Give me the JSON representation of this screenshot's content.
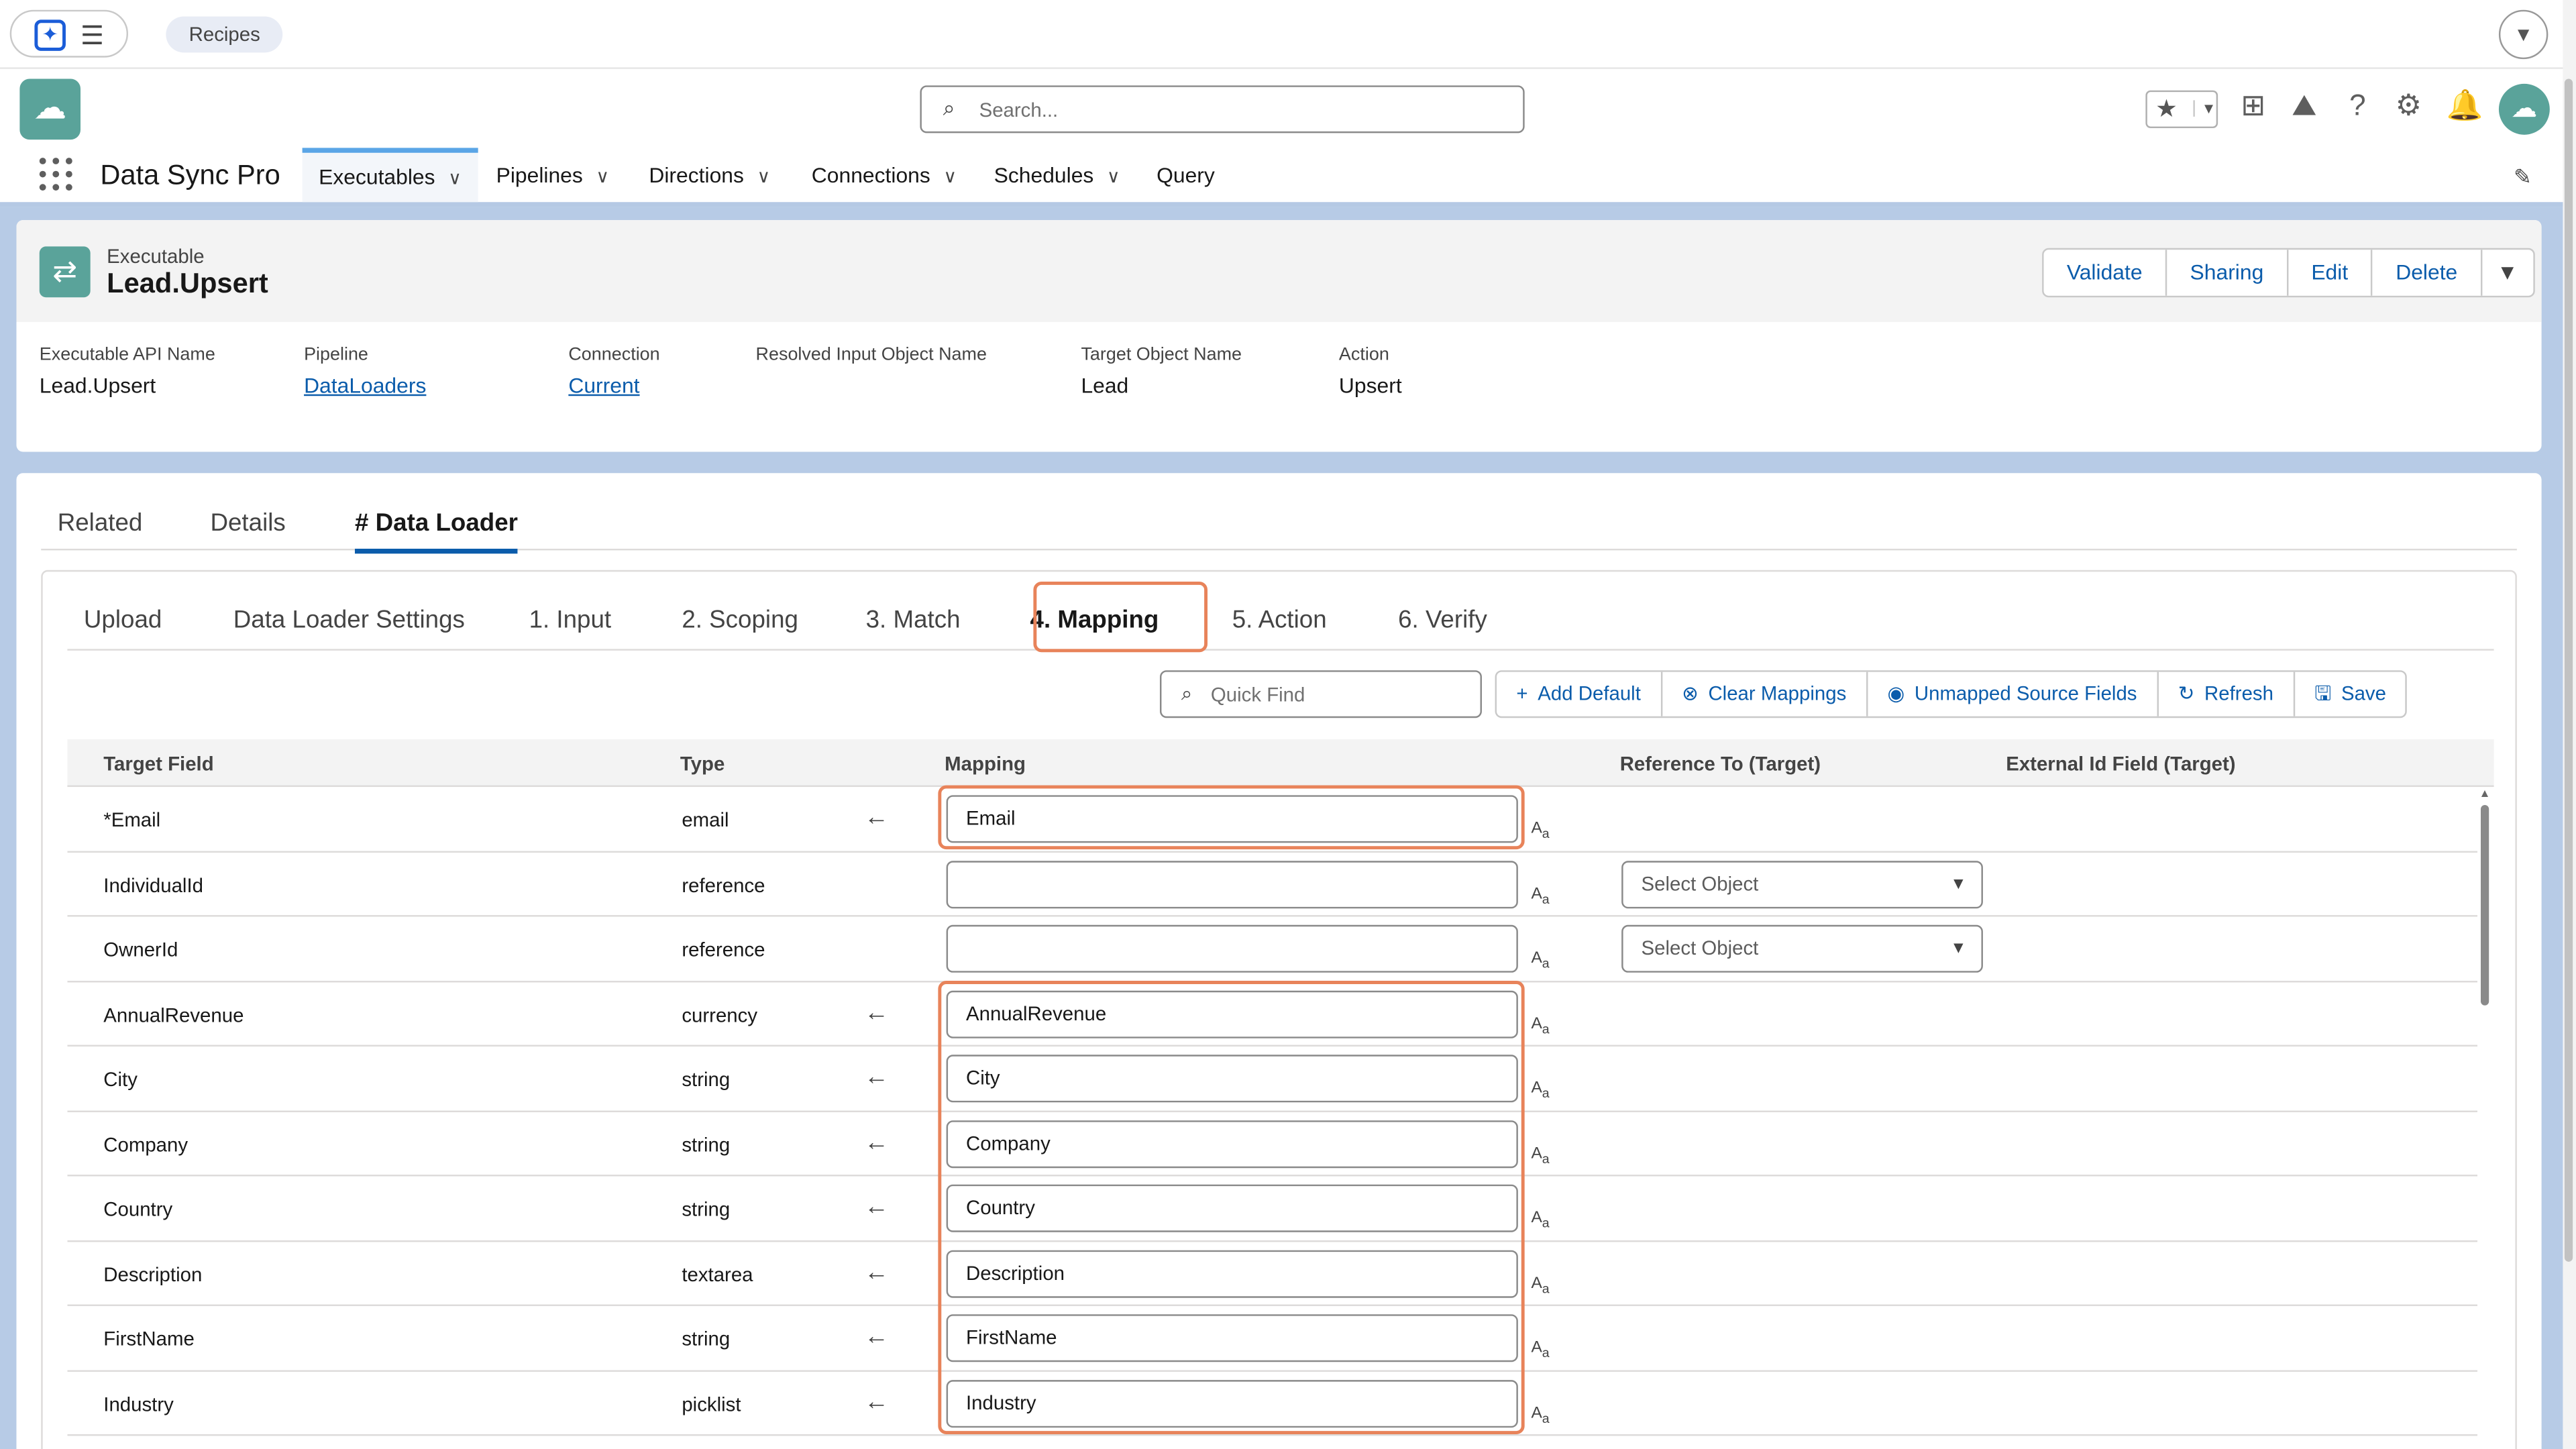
{
  "browser": {
    "tab_label": "Recipes"
  },
  "header": {
    "search_placeholder": "Search..."
  },
  "appnav": {
    "app_name": "Data Sync Pro",
    "items": [
      {
        "label": "Executables",
        "active": true,
        "has_menu": true
      },
      {
        "label": "Pipelines",
        "has_menu": true
      },
      {
        "label": "Directions",
        "has_menu": true
      },
      {
        "label": "Connections",
        "has_menu": true
      },
      {
        "label": "Schedules",
        "has_menu": true
      },
      {
        "label": "Query",
        "has_menu": false
      }
    ]
  },
  "record": {
    "object_type": "Executable",
    "name": "Lead.Upsert",
    "actions": [
      "Validate",
      "Sharing",
      "Edit",
      "Delete"
    ],
    "fields": [
      {
        "label": "Executable API Name",
        "value": "Lead.Upsert",
        "link": false
      },
      {
        "label": "Pipeline",
        "value": "DataLoaders",
        "link": true
      },
      {
        "label": "Connection",
        "value": "Current",
        "link": true
      },
      {
        "label": "Resolved Input Object Name",
        "value": "",
        "link": false
      },
      {
        "label": "Target Object Name",
        "value": "Lead",
        "link": false
      },
      {
        "label": "Action",
        "value": "Upsert",
        "link": false
      }
    ]
  },
  "tabs": [
    "Related",
    "Details",
    "# Data Loader"
  ],
  "active_tab": "# Data Loader",
  "subtabs": [
    "Upload",
    "Data Loader Settings",
    "1. Input",
    "2. Scoping",
    "3. Match",
    "4. Mapping",
    "5. Action",
    "6. Verify"
  ],
  "active_subtab": "4. Mapping",
  "toolbar": {
    "quick_find_placeholder": "Quick Find",
    "buttons": [
      "Add Default",
      "Clear Mappings",
      "Unmapped Source Fields",
      "Refresh",
      "Save"
    ]
  },
  "table": {
    "columns": [
      "Target Field",
      "Type",
      "Mapping",
      "Reference To (Target)",
      "External Id Field (Target)"
    ],
    "select_placeholder": "Select Object",
    "type_indicator": "Aa",
    "rows": [
      {
        "target": "*Email",
        "type": "email",
        "mapped": true,
        "mapping": "Email",
        "reference": false
      },
      {
        "target": "IndividualId",
        "type": "reference",
        "mapped": false,
        "mapping": "",
        "reference": true
      },
      {
        "target": "OwnerId",
        "type": "reference",
        "mapped": false,
        "mapping": "",
        "reference": true
      },
      {
        "target": "AnnualRevenue",
        "type": "currency",
        "mapped": true,
        "mapping": "AnnualRevenue",
        "reference": false
      },
      {
        "target": "City",
        "type": "string",
        "mapped": true,
        "mapping": "City",
        "reference": false
      },
      {
        "target": "Company",
        "type": "string",
        "mapped": true,
        "mapping": "Company",
        "reference": false
      },
      {
        "target": "Country",
        "type": "string",
        "mapped": true,
        "mapping": "Country",
        "reference": false
      },
      {
        "target": "Description",
        "type": "textarea",
        "mapped": true,
        "mapping": "Description",
        "reference": false
      },
      {
        "target": "FirstName",
        "type": "string",
        "mapped": true,
        "mapping": "FirstName",
        "reference": false
      },
      {
        "target": "Industry",
        "type": "picklist",
        "mapped": true,
        "mapping": "Industry",
        "reference": false
      }
    ]
  },
  "colors": {
    "brand": "#0b5cab",
    "app_icon": "#5aa39a",
    "highlight": "#e8835a",
    "page_bg": "#b7cbe6"
  }
}
